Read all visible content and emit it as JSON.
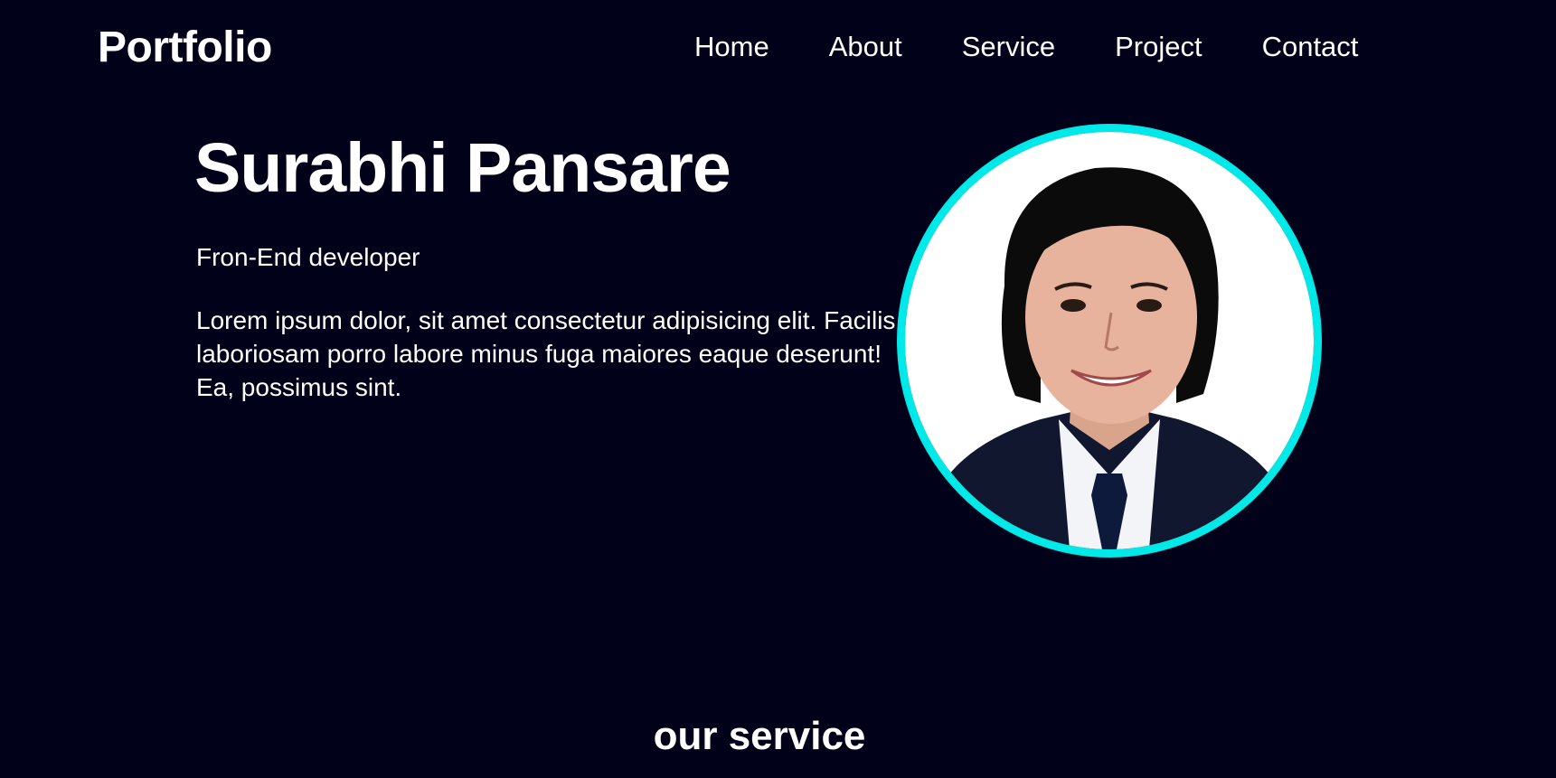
{
  "header": {
    "brand": "Portfolio",
    "nav": [
      {
        "label": "Home"
      },
      {
        "label": "About"
      },
      {
        "label": "Service"
      },
      {
        "label": "Project"
      },
      {
        "label": "Contact"
      }
    ]
  },
  "hero": {
    "name": "Surabhi Pansare",
    "role": "Fron-End developer",
    "description": "Lorem ipsum dolor, sit amet consectetur adipisicing elit. Facilis laboriosam porro labore minus fuga maiores eaque deserunt! Ea, possimus sint.",
    "ring_color": "#00e9e9"
  },
  "services": {
    "title": "our service"
  },
  "colors": {
    "background": "#01011a",
    "text": "#ffffff",
    "accent": "#00e9e9"
  }
}
